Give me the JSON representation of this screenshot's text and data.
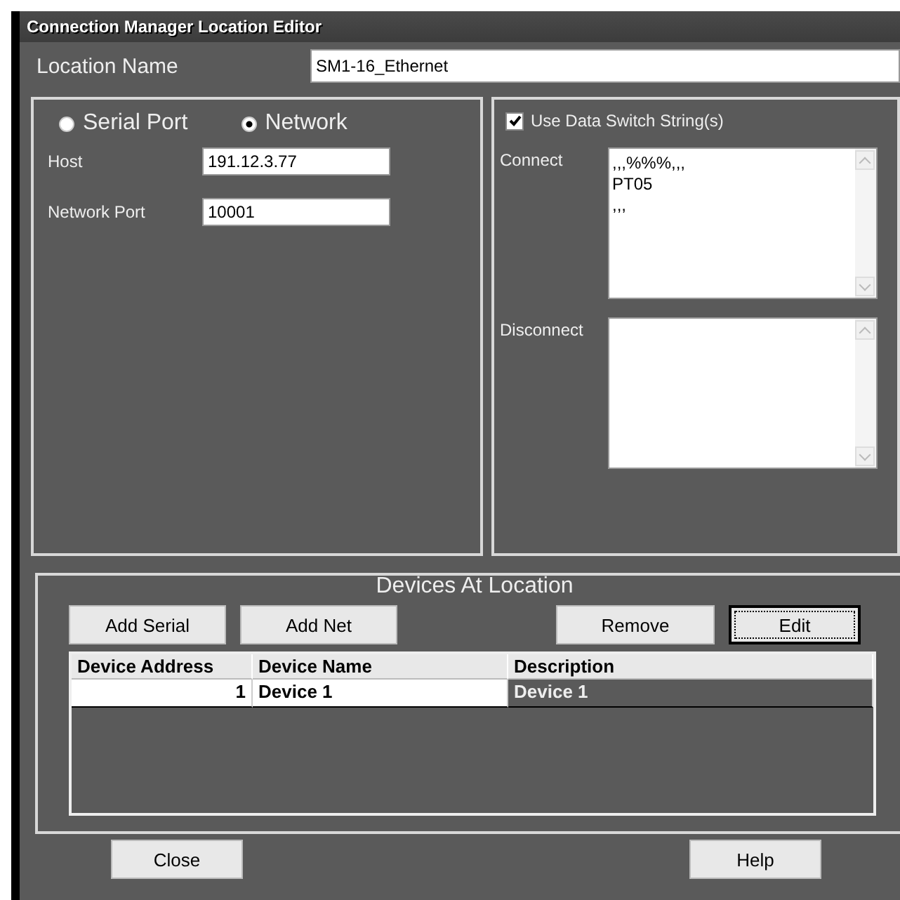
{
  "window": {
    "title": "Connection Manager Location Editor"
  },
  "location_name": {
    "label": "Location Name",
    "value": "SM1-16_Ethernet"
  },
  "connection_type": [
    {
      "label": "Serial Port",
      "selected": false
    },
    {
      "label": "Network",
      "selected": true
    }
  ],
  "network": {
    "fields": [
      {
        "label": "Host",
        "value": "191.12.3.77"
      },
      {
        "label": "Network Port",
        "value": "10001"
      }
    ]
  },
  "data_switch": {
    "label": "Use Data Switch String(s)",
    "checked": true,
    "connect": {
      "label": "Connect",
      "lines": [
        ",,,%%%,,,",
        "PT05",
        ",,,"
      ]
    },
    "disconnect": {
      "label": "Disconnect"
    }
  },
  "devices": {
    "title": "Devices At Location",
    "left_buttons": [
      {
        "label": "Add Serial",
        "focused": false
      },
      {
        "label": "Add Net",
        "focused": false
      }
    ],
    "right_buttons": [
      {
        "label": "Remove",
        "focused": false
      },
      {
        "label": "Edit",
        "focused": true
      }
    ],
    "table": {
      "columns": [
        "Device Address",
        "Device Name",
        "Description"
      ],
      "rows": [
        {
          "cells": [
            "1",
            "Device 1",
            "Device 1"
          ],
          "selected": true
        }
      ]
    }
  },
  "footer_buttons": [
    {
      "label": "Close"
    },
    {
      "label": "Help"
    }
  ]
}
